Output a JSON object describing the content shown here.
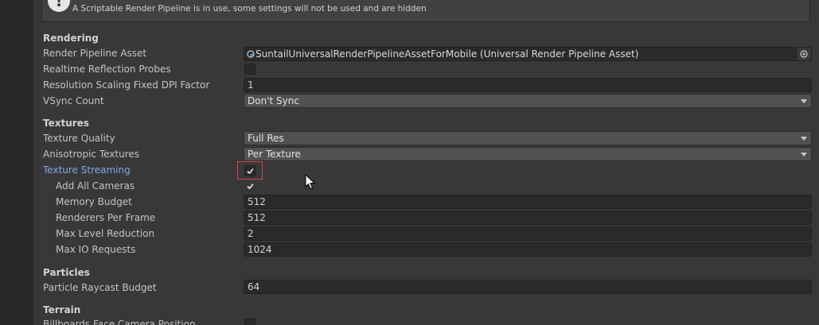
{
  "help": {
    "text": "A Scriptable Render Pipeline is in use, some settings will not be used and are hidden",
    "icon": "info-exclamation-icon"
  },
  "sections": {
    "rendering": "Rendering",
    "textures": "Textures",
    "particles": "Particles",
    "terrain": "Terrain"
  },
  "rendering": {
    "pipeline_asset_label": "Render Pipeline Asset",
    "pipeline_asset_value": "SuntailUniversalRenderPipelineAssetForMobile (Universal Render Pipeline Asset)",
    "reflection_probes_label": "Realtime Reflection Probes",
    "reflection_probes_checked": false,
    "dpi_factor_label": "Resolution Scaling Fixed DPI Factor",
    "dpi_factor_value": "1",
    "vsync_label": "VSync Count",
    "vsync_value": "Don't Sync"
  },
  "textures": {
    "quality_label": "Texture Quality",
    "quality_value": "Full Res",
    "anisotropic_label": "Anisotropic Textures",
    "anisotropic_value": "Per Texture",
    "streaming_label": "Texture Streaming",
    "streaming_checked": true,
    "add_all_cameras_label": "Add All Cameras",
    "add_all_cameras_checked": true,
    "memory_budget_label": "Memory Budget",
    "memory_budget_value": "512",
    "renderers_per_frame_label": "Renderers Per Frame",
    "renderers_per_frame_value": "512",
    "max_level_reduction_label": "Max Level Reduction",
    "max_level_reduction_value": "2",
    "max_io_requests_label": "Max IO Requests",
    "max_io_requests_value": "1024"
  },
  "particles": {
    "raycast_budget_label": "Particle Raycast Budget",
    "raycast_budget_value": "64"
  },
  "terrain": {
    "billboards_label": "Billboards Face Camera Position",
    "billboards_checked": false
  },
  "colors": {
    "panel_bg": "#383838",
    "field_bg": "#2a2a2a",
    "dropdown_bg": "#515151",
    "active_label": "#7fa8e8",
    "highlight": "#e04444"
  }
}
